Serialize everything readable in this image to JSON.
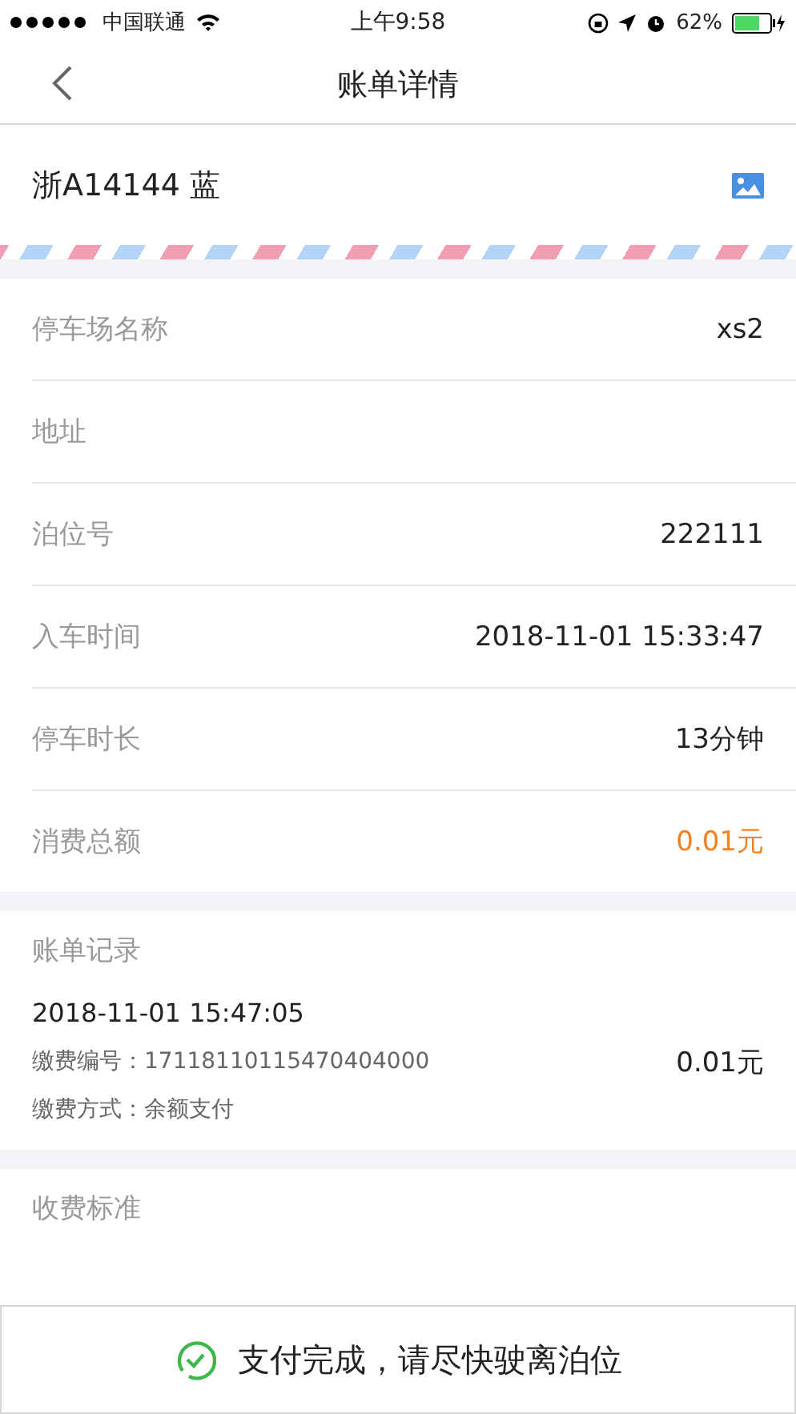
{
  "status_bar": {
    "carrier": "中国联通",
    "time": "上午9:58",
    "battery": "62%"
  },
  "nav": {
    "title": "账单详情"
  },
  "plate": {
    "text": "浙A14144 蓝"
  },
  "details": [
    {
      "label": "停车场名称",
      "value": "xs2",
      "kind": "plain"
    },
    {
      "label": "地址"
    },
    {
      "label": "泊位号",
      "value": "222111",
      "kind": "plain"
    },
    {
      "label": "入车时间",
      "value": "2018-11-01 15:33:47",
      "kind": "plain"
    },
    {
      "label": "停车时长",
      "value": "13分钟",
      "kind": "plain"
    },
    {
      "label": "消费总额",
      "value": "0.01元",
      "kind": "amount"
    }
  ],
  "records": {
    "title": "账单记录",
    "items": [
      {
        "time": "2018-11-01 15:47:05",
        "number_label": "缴费编号：",
        "number": "17118110115470404000",
        "method_label": "缴费方式：",
        "method": "余额支付",
        "amount": "0.01元"
      }
    ]
  },
  "fee_standard": {
    "title": "收费标准"
  },
  "footer": {
    "message": "支付完成，请尽快驶离泊位"
  }
}
